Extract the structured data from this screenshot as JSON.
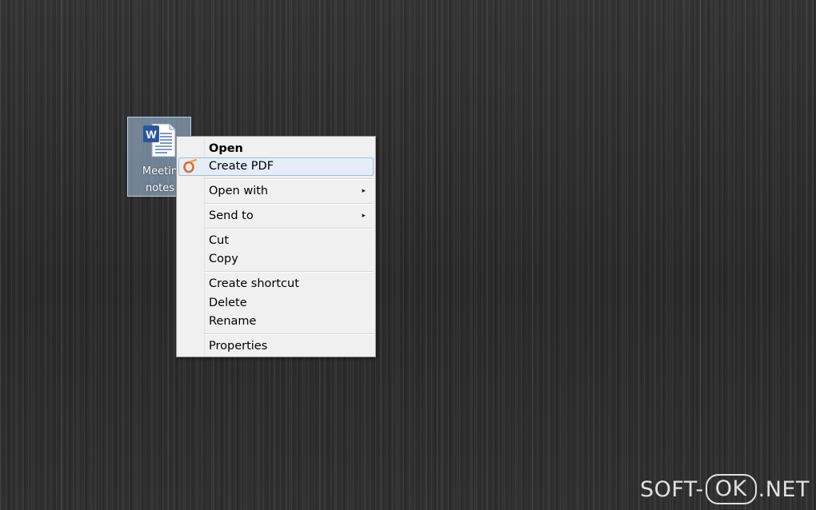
{
  "desktop": {
    "icon": {
      "name": "Meeting notes",
      "label_line1": "Meetin",
      "label_line2": "notes",
      "icon_letter": "W"
    }
  },
  "context_menu": {
    "items": [
      {
        "label": "Open",
        "bold": true
      },
      {
        "label": "Create PDF",
        "highlighted": true,
        "icon": "pdf-creator-icon"
      },
      {
        "label": "Open with",
        "submenu": true
      },
      {
        "label": "Send to",
        "submenu": true
      },
      {
        "label": "Cut"
      },
      {
        "label": "Copy"
      },
      {
        "label": "Create shortcut"
      },
      {
        "label": "Delete"
      },
      {
        "label": "Rename"
      },
      {
        "label": "Properties"
      }
    ],
    "submenu_arrow": "▸"
  },
  "watermark": {
    "part1": "SOFT-",
    "part2": "OK",
    "part3": ".NET"
  },
  "colors": {
    "menu_background": "#f0f0f0",
    "menu_highlight": "#e5eef8",
    "menu_highlight_border": "#9ebbdd",
    "icon_selection": "#aac8eb",
    "word_blue": "#2b5797",
    "pdf_orange": "#e8692b"
  }
}
